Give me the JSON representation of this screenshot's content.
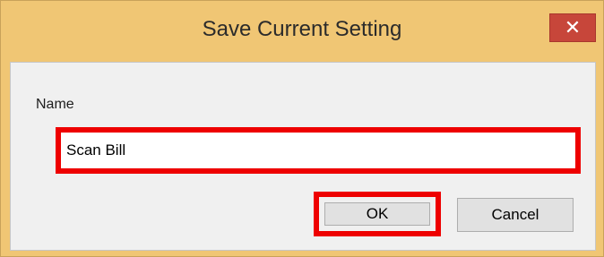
{
  "window": {
    "title": "Save Current Setting",
    "close_glyph": "✕",
    "frame_color": "#f0c674",
    "close_color": "#c7463a"
  },
  "form": {
    "name_label": "Name",
    "name_value": "Scan Bill"
  },
  "buttons": {
    "ok_label": "OK",
    "cancel_label": "Cancel"
  },
  "highlight_color": "#ee0000"
}
